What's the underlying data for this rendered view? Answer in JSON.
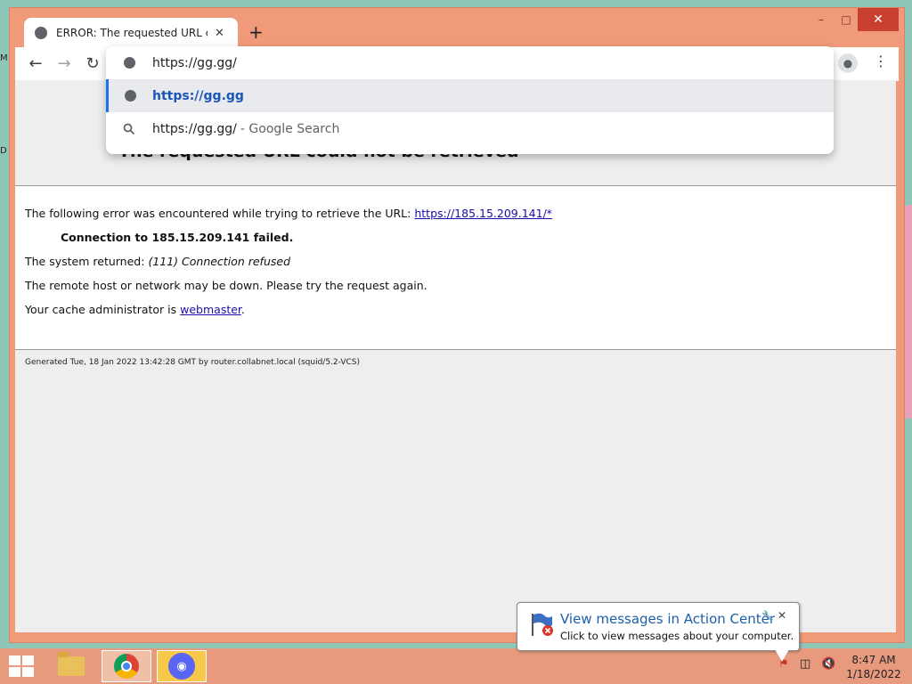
{
  "desktop": {
    "edge_letters": [
      "M",
      "D"
    ]
  },
  "browser": {
    "tab": {
      "title": "ERROR: The requested URL could not be retrieved",
      "icon": "globe-icon",
      "close_icon": "close-icon"
    },
    "new_tab_label": "+",
    "window_controls": {
      "minimize": "–",
      "maximize": "□",
      "close": "✕"
    },
    "toolbar": {
      "back": "←",
      "forward": "→",
      "reload": "↻",
      "menu": "⋮"
    },
    "omnibox": {
      "input_value": "https://gg.gg/",
      "suggestions": [
        {
          "icon": "globe-icon",
          "text": "https://gg.gg",
          "suffix": ""
        },
        {
          "icon": "search-icon",
          "text": "https://gg.gg/",
          "suffix": "- Google Search"
        }
      ]
    }
  },
  "page": {
    "title": "The requested URL could not be retrieved",
    "error_intro": "The following error was encountered while trying to retrieve the URL:",
    "error_url": "https://185.15.209.141/*",
    "connection_failed": "Connection to 185.15.209.141 failed.",
    "system_returned_label": "The system returned:",
    "system_returned_value": "(111) Connection refused",
    "remote_host_msg": "The remote host or network may be down. Please try the request again.",
    "cache_admin_label": "Your cache administrator is",
    "cache_admin_link": "webmaster",
    "cache_admin_end": ".",
    "footer": "Generated Tue, 18 Jan 2022 13:42:28 GMT by router.collabnet.local (squid/5.2-VCS)"
  },
  "notification": {
    "title": "View messages in Action Center",
    "body": "Click to view messages about your computer.",
    "close": "✕",
    "options_icon": "wrench-icon"
  },
  "taskbar": {
    "apps": [
      "file-explorer-icon",
      "chrome-icon",
      "discord-icon"
    ],
    "clock_time": "8:47 AM",
    "clock_date": "1/18/2022"
  },
  "colors": {
    "window_frame": "#f09a7a",
    "taskbar": "#e79a7e",
    "link": "#1a0dab",
    "omni_selected": "#1a56b8"
  }
}
